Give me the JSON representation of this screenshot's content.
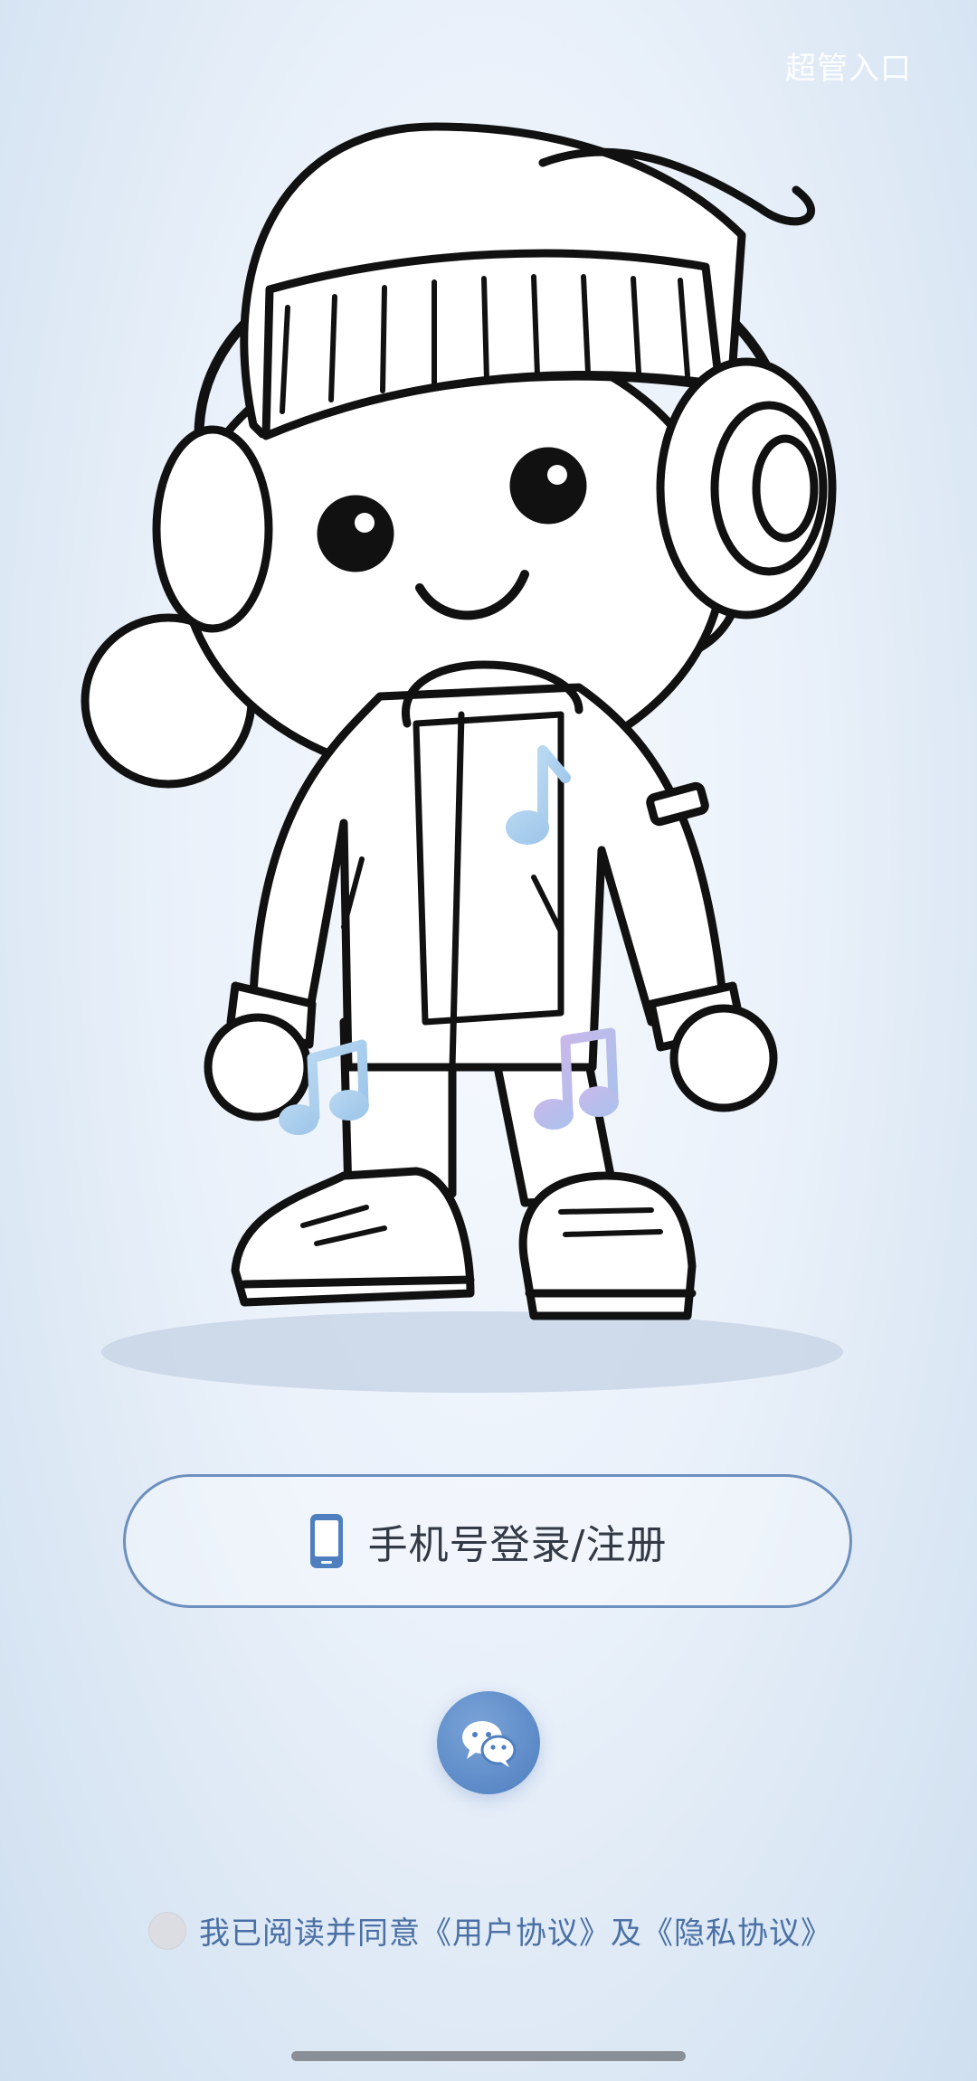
{
  "header": {
    "admin_entry": "超管入口"
  },
  "login": {
    "phone_button_label": "手机号登录/注册",
    "phone_icon": "mobile-phone-icon",
    "wechat_icon": "wechat-icon"
  },
  "agreement": {
    "prefix": "我已阅读并同意",
    "user_agreement": "《用户协议》",
    "conjunction": "及",
    "privacy_policy": "《隐私协议》",
    "checked": false
  },
  "colors": {
    "accent": "#4f7fbf",
    "button_border": "#6d8fbe",
    "agreement_text": "#4a70a6"
  }
}
